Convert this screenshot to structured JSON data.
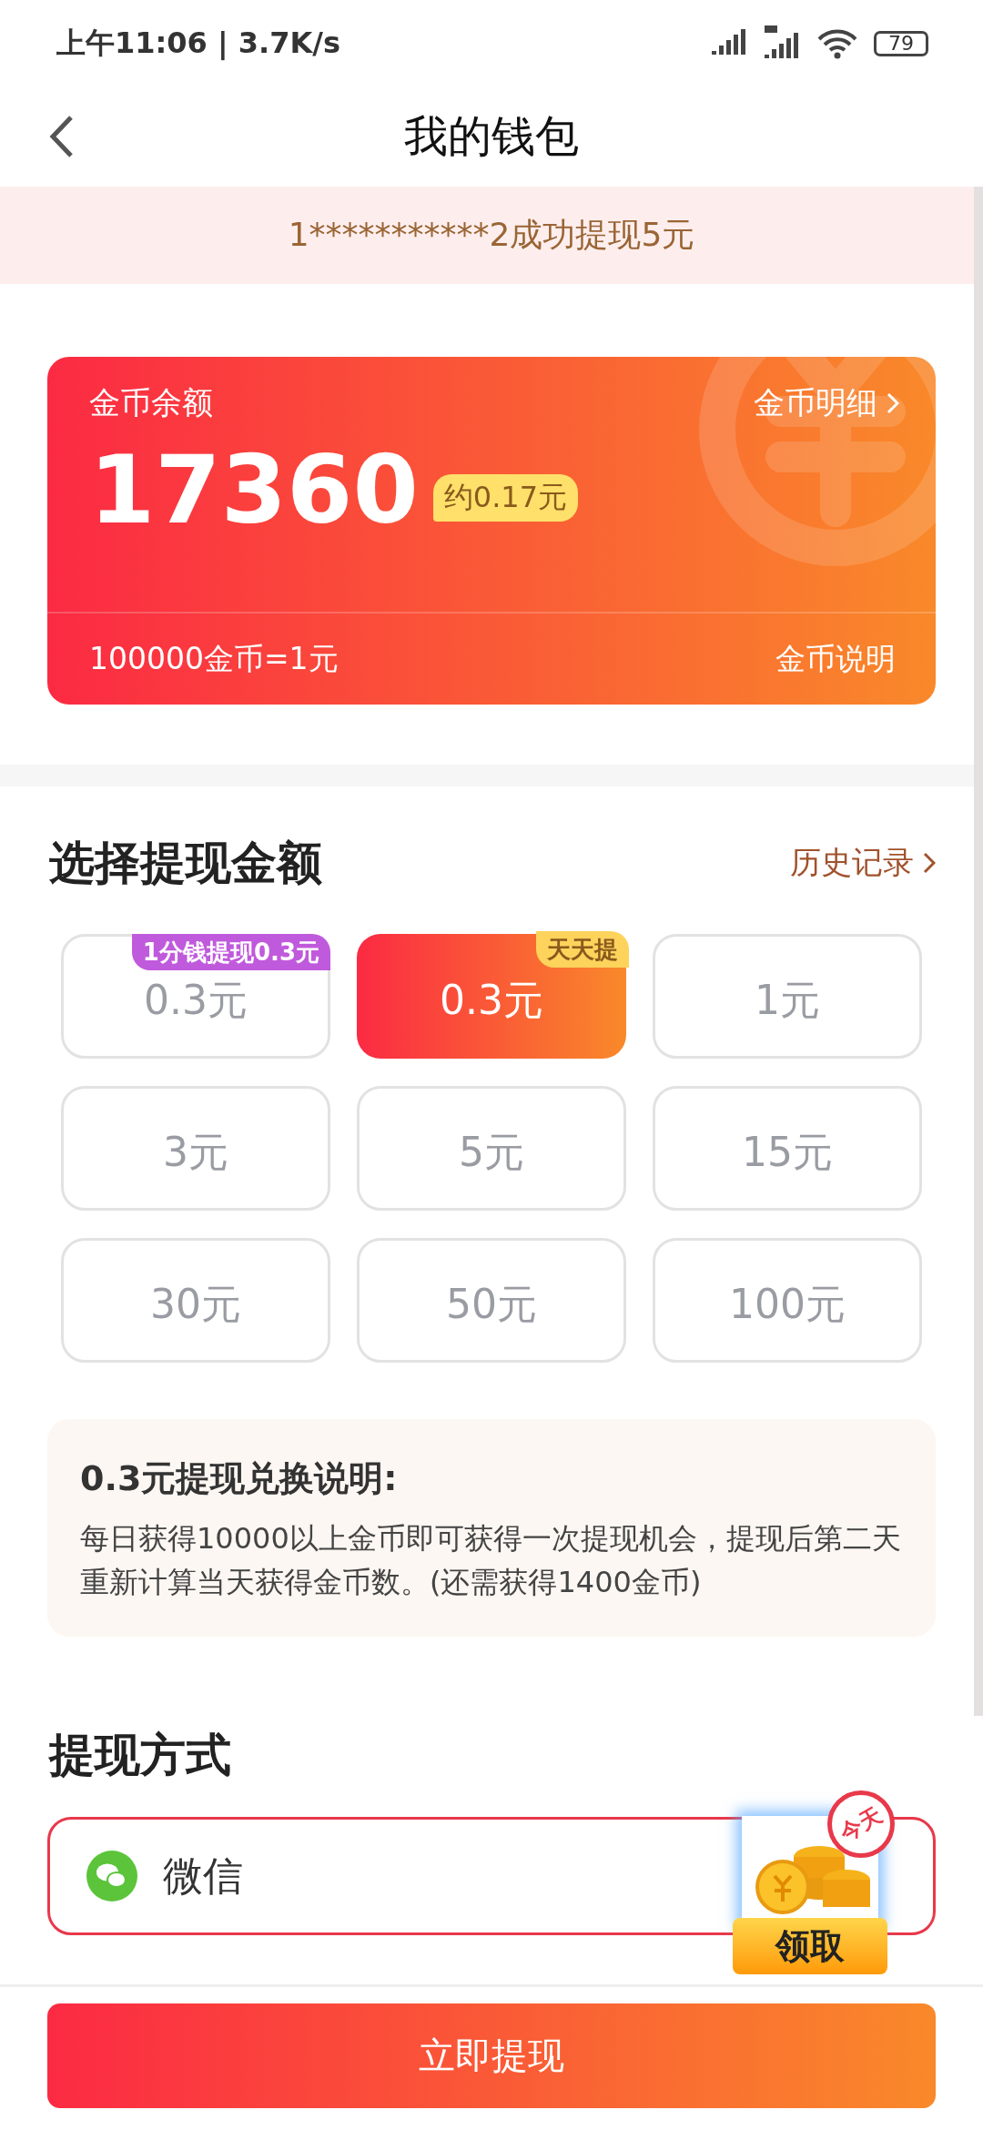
{
  "status_bar": {
    "time": "上午11:06 | 3.7K/s",
    "battery": "79"
  },
  "nav": {
    "title": "我的钱包"
  },
  "notice": "1***********2成功提现5元",
  "balance_card": {
    "label": "金币余额",
    "detail_link": "金币明细",
    "balance": "17360",
    "approx": "约0.17元",
    "rate": "100000金币=1元",
    "explain_link": "金币说明"
  },
  "withdraw": {
    "heading": "选择提现金额",
    "history_link": "历史记录",
    "options": [
      {
        "amount": "0.3元",
        "selected": false,
        "tag": "1分钱提现0.3元",
        "color": "#c05adc"
      },
      {
        "amount": "0.3元",
        "selected": true,
        "tag": "天天提",
        "color": "#fdd35c"
      },
      {
        "amount": "1元",
        "selected": false
      },
      {
        "amount": "3元",
        "selected": false
      },
      {
        "amount": "5元",
        "selected": false
      },
      {
        "amount": "15元",
        "selected": false
      },
      {
        "amount": "30元",
        "selected": false
      },
      {
        "amount": "50元",
        "selected": false
      },
      {
        "amount": "100元",
        "selected": false
      }
    ]
  },
  "info": {
    "title": "0.3元提现兑换说明:",
    "body": "每日获得10000以上金币即可获得一次提现机会，提现后第二天重新计算当天获得金币数。(还需获得1400金币)"
  },
  "method": {
    "heading": "提现方式",
    "options": [
      {
        "label": "微信",
        "selected": true
      }
    ]
  },
  "reward_widget": {
    "badge": "今天",
    "button": "领取"
  },
  "submit": "立即提现"
}
